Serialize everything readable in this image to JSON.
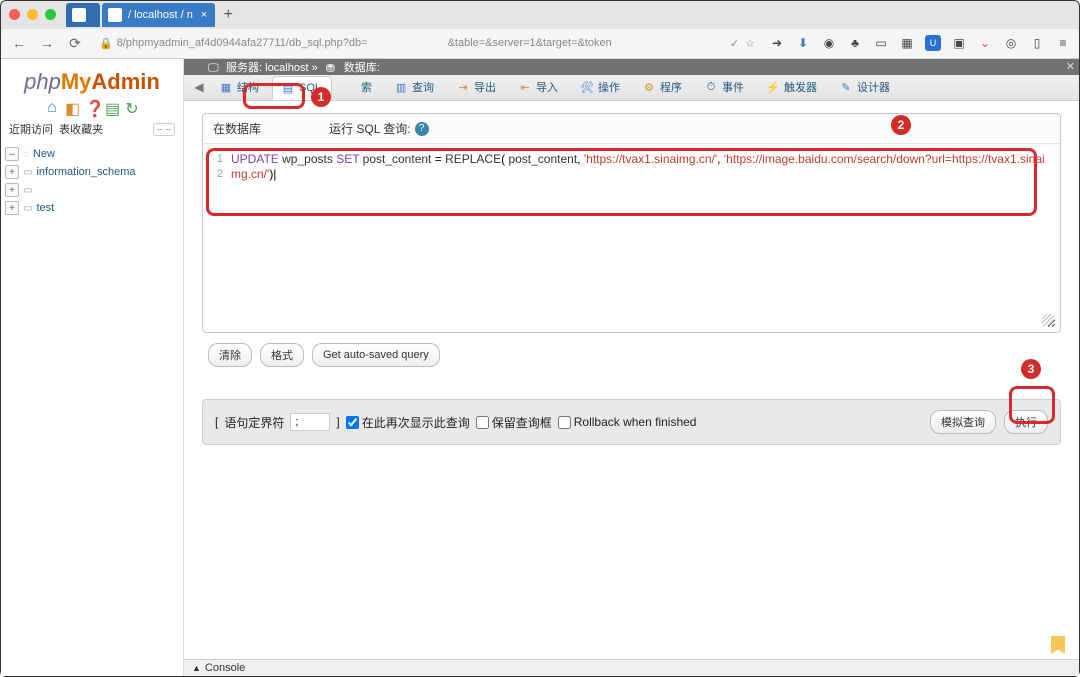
{
  "browser": {
    "tab1_title": "",
    "tab2_title": "/ localhost / n",
    "url_visible_prefix": "8/phpmyadmin_af4d0944afa27711/db_sql.php?db=",
    "url_visible_suffix": "&table=&server=1&target=&token",
    "new_tab": "+"
  },
  "logo": {
    "php": "php",
    "my": "My",
    "admin": "Admin"
  },
  "sidebar": {
    "recent_label": "近期访问",
    "fav_label": "表收藏夹",
    "collapse": "– –",
    "nodes": [
      {
        "label": "New"
      },
      {
        "label": "information_schema"
      },
      {
        "label": ""
      },
      {
        "label": "test"
      }
    ]
  },
  "breadcrumb": {
    "server_label": "服务器:",
    "server_value": "localhost",
    "db_label": "数据库:",
    "db_value": ""
  },
  "tabs": {
    "structure": "结构",
    "sql": "SQL",
    "search": "索",
    "query": "查询",
    "export": "导出",
    "import": "导入",
    "operations": "操作",
    "routines": "程序",
    "events": "事件",
    "triggers": "触发器",
    "designer": "设计器"
  },
  "fieldset": {
    "title_prefix": "在数据库",
    "title_db": "",
    "title_suffix": "运行 SQL 查询:"
  },
  "sql": {
    "keyword_update": "UPDATE",
    "table": "wp_posts",
    "keyword_set": "SET",
    "column": "post_content",
    "eq": "=",
    "func": "REPLACE",
    "open": "(",
    "arg1": "post_content",
    "comma": ",",
    "str1": "'https://tvax1.sinaimg.cn/'",
    "str2": "'https://image.baidu.com/search/down?url=https://tvax1.sinaimg.cn/'",
    "close": ")|"
  },
  "buttons": {
    "clear": "清除",
    "format": "格式",
    "autosaved": "Get auto-saved query",
    "simulate": "模拟查询",
    "execute": "执行"
  },
  "options": {
    "delim_label_open": "[",
    "delim_label": "语句定界符",
    "delim_value": ";",
    "delim_label_close": "]",
    "show_again": "在此再次显示此查询",
    "retain_box": "保留查询框",
    "rollback": "Rollback when finished"
  },
  "console": "Console",
  "badges": {
    "one": "1",
    "two": "2",
    "three": "3"
  }
}
